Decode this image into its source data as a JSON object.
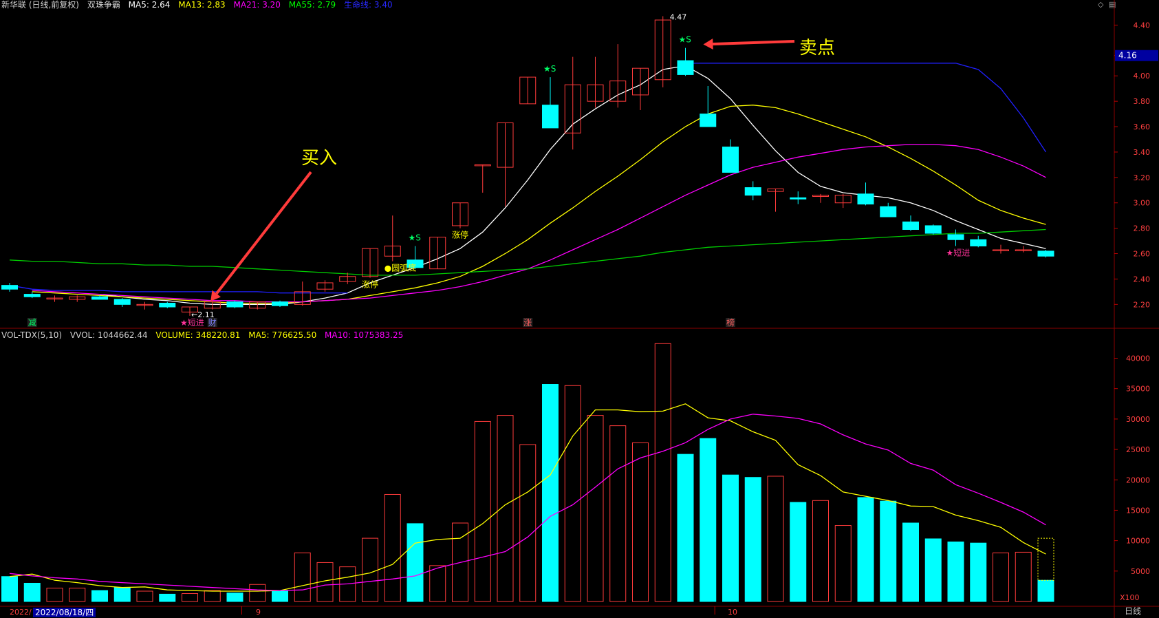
{
  "header": {
    "title": "新华联 (日线,前复权)",
    "indicator": "双珠争霸",
    "ma5": "MA5: 2.64",
    "ma13": "MA13: 2.83",
    "ma21": "MA21: 3.20",
    "ma55": "MA55: 2.79",
    "lifeline": "生命线: 3.40"
  },
  "vol_header": {
    "name": "VOL-TDX(5,10)",
    "vvol": "VVOL: 1044662.44",
    "volume": "VOLUME: 348220.81",
    "ma5": "MA5: 776625.50",
    "ma10": "MA10: 1075383.25"
  },
  "bottom": {
    "year_label": "2022/",
    "cursor_date": "2022/08/18/四",
    "month_9": "9",
    "month_10": "10",
    "period": "日线"
  },
  "colors": {
    "up": "#ff3b3b",
    "down": "#00ffff",
    "ma5": "#ffffff",
    "ma13": "#ffff00",
    "ma21": "#ff00ff",
    "ma55": "#00cc00",
    "lifeline": "#2020ff",
    "grid": "#8b0000"
  },
  "chart_data": [
    {
      "type": "candlestick",
      "title": "新华联 (日线,前复权)",
      "ylim": [
        2.05,
        4.5
      ],
      "y_ticks": [
        "4.40",
        "4.16",
        "4.00",
        "3.80",
        "3.60",
        "3.40",
        "3.20",
        "3.00",
        "2.80",
        "2.60",
        "2.40",
        "2.20"
      ],
      "current_price_label": "4.16",
      "candles": [
        {
          "o": 2.35,
          "h": 2.37,
          "l": 2.3,
          "c": 2.32
        },
        {
          "o": 2.28,
          "h": 2.3,
          "l": 2.25,
          "c": 2.26
        },
        {
          "o": 2.25,
          "h": 2.27,
          "l": 2.22,
          "c": 2.25
        },
        {
          "o": 2.24,
          "h": 2.27,
          "l": 2.22,
          "c": 2.26
        },
        {
          "o": 2.26,
          "h": 2.27,
          "l": 2.24,
          "c": 2.24
        },
        {
          "o": 2.24,
          "h": 2.25,
          "l": 2.18,
          "c": 2.2
        },
        {
          "o": 2.2,
          "h": 2.22,
          "l": 2.16,
          "c": 2.2
        },
        {
          "o": 2.21,
          "h": 2.22,
          "l": 2.17,
          "c": 2.18
        },
        {
          "o": 2.14,
          "h": 2.18,
          "l": 2.11,
          "c": 2.18
        },
        {
          "o": 2.17,
          "h": 2.22,
          "l": 2.16,
          "c": 2.22
        },
        {
          "o": 2.22,
          "h": 2.23,
          "l": 2.17,
          "c": 2.18
        },
        {
          "o": 2.17,
          "h": 2.22,
          "l": 2.16,
          "c": 2.22
        },
        {
          "o": 2.22,
          "h": 2.23,
          "l": 2.18,
          "c": 2.19
        },
        {
          "o": 2.2,
          "h": 2.38,
          "l": 2.19,
          "c": 2.3
        },
        {
          "o": 2.32,
          "h": 2.39,
          "l": 2.3,
          "c": 2.37
        },
        {
          "o": 2.38,
          "h": 2.45,
          "l": 2.36,
          "c": 2.42
        },
        {
          "o": 2.42,
          "h": 2.64,
          "l": 2.41,
          "c": 2.64
        },
        {
          "o": 2.58,
          "h": 2.9,
          "l": 2.54,
          "c": 2.66
        },
        {
          "o": 2.55,
          "h": 2.66,
          "l": 2.48,
          "c": 2.49
        },
        {
          "o": 2.48,
          "h": 2.73,
          "l": 2.48,
          "c": 2.73
        },
        {
          "o": 2.82,
          "h": 3.0,
          "l": 2.8,
          "c": 3.0
        },
        {
          "o": 3.3,
          "h": 3.3,
          "l": 3.08,
          "c": 3.3
        },
        {
          "o": 3.28,
          "h": 3.63,
          "l": 2.97,
          "c": 3.63
        },
        {
          "o": 3.78,
          "h": 3.99,
          "l": 3.78,
          "c": 3.99
        },
        {
          "o": 3.77,
          "h": 3.99,
          "l": 3.59,
          "c": 3.59
        },
        {
          "o": 3.55,
          "h": 4.15,
          "l": 3.42,
          "c": 3.93
        },
        {
          "o": 3.8,
          "h": 4.15,
          "l": 3.75,
          "c": 3.93
        },
        {
          "o": 3.8,
          "h": 4.25,
          "l": 3.75,
          "c": 3.96
        },
        {
          "o": 3.85,
          "h": 4.06,
          "l": 3.73,
          "c": 4.06
        },
        {
          "o": 3.97,
          "h": 4.47,
          "l": 3.91,
          "c": 4.44
        },
        {
          "o": 4.12,
          "h": 4.22,
          "l": 4.0,
          "c": 4.01
        },
        {
          "o": 3.7,
          "h": 3.92,
          "l": 3.6,
          "c": 3.6
        },
        {
          "o": 3.44,
          "h": 3.5,
          "l": 3.24,
          "c": 3.24
        },
        {
          "o": 3.12,
          "h": 3.17,
          "l": 3.02,
          "c": 3.06
        },
        {
          "o": 3.09,
          "h": 3.11,
          "l": 2.93,
          "c": 3.11
        },
        {
          "o": 3.04,
          "h": 3.09,
          "l": 2.99,
          "c": 3.03
        },
        {
          "o": 3.05,
          "h": 3.07,
          "l": 3.0,
          "c": 3.06
        },
        {
          "o": 3.0,
          "h": 3.07,
          "l": 2.96,
          "c": 3.06
        },
        {
          "o": 3.07,
          "h": 3.16,
          "l": 2.98,
          "c": 2.99
        },
        {
          "o": 2.97,
          "h": 3.0,
          "l": 2.89,
          "c": 2.89
        },
        {
          "o": 2.85,
          "h": 2.9,
          "l": 2.78,
          "c": 2.79
        },
        {
          "o": 2.82,
          "h": 2.83,
          "l": 2.75,
          "c": 2.76
        },
        {
          "o": 2.75,
          "h": 2.79,
          "l": 2.66,
          "c": 2.71
        },
        {
          "o": 2.71,
          "h": 2.74,
          "l": 2.65,
          "c": 2.66
        },
        {
          "o": 2.63,
          "h": 2.67,
          "l": 2.6,
          "c": 2.63
        },
        {
          "o": 2.63,
          "h": 2.66,
          "l": 2.61,
          "c": 2.63
        },
        {
          "o": 2.62,
          "h": 2.63,
          "l": 2.57,
          "c": 2.58
        }
      ],
      "series": [
        {
          "name": "MA5",
          "color": "#ffffff",
          "values": [
            null,
            null,
            null,
            null,
            2.28,
            2.26,
            2.24,
            2.23,
            2.21,
            2.2,
            2.2,
            2.2,
            2.2,
            2.22,
            2.25,
            2.29,
            2.37,
            2.43,
            2.49,
            2.56,
            2.64,
            2.77,
            2.96,
            3.18,
            3.42,
            3.62,
            3.74,
            3.85,
            3.93,
            4.05,
            4.08,
            3.98,
            3.82,
            3.61,
            3.41,
            3.24,
            3.13,
            3.08,
            3.06,
            3.04,
            3.0,
            2.94,
            2.86,
            2.79,
            2.72,
            2.68,
            2.64
          ]
        },
        {
          "name": "MA13",
          "color": "#ffff00",
          "values": [
            null,
            2.3,
            2.29,
            2.28,
            2.27,
            2.26,
            2.25,
            2.24,
            2.23,
            2.22,
            2.21,
            2.21,
            2.21,
            2.22,
            2.23,
            2.24,
            2.27,
            2.3,
            2.33,
            2.37,
            2.42,
            2.5,
            2.6,
            2.71,
            2.84,
            2.96,
            3.09,
            3.21,
            3.34,
            3.48,
            3.6,
            3.7,
            3.76,
            3.77,
            3.75,
            3.7,
            3.64,
            3.58,
            3.52,
            3.44,
            3.35,
            3.25,
            3.14,
            3.02,
            2.94,
            2.88,
            2.83
          ]
        },
        {
          "name": "MA21",
          "color": "#ff00ff",
          "values": [
            null,
            2.31,
            2.3,
            2.29,
            2.28,
            2.27,
            2.26,
            2.25,
            2.24,
            2.23,
            2.23,
            2.22,
            2.22,
            2.22,
            2.23,
            2.24,
            2.25,
            2.27,
            2.29,
            2.31,
            2.34,
            2.38,
            2.43,
            2.48,
            2.55,
            2.63,
            2.71,
            2.79,
            2.88,
            2.97,
            3.06,
            3.14,
            3.22,
            3.28,
            3.32,
            3.36,
            3.39,
            3.42,
            3.44,
            3.45,
            3.46,
            3.46,
            3.45,
            3.42,
            3.36,
            3.29,
            3.2
          ]
        },
        {
          "name": "MA55",
          "color": "#00cc00",
          "values": [
            2.55,
            2.54,
            2.54,
            2.53,
            2.52,
            2.52,
            2.51,
            2.51,
            2.5,
            2.5,
            2.49,
            2.48,
            2.47,
            2.46,
            2.45,
            2.44,
            2.43,
            2.43,
            2.43,
            2.44,
            2.45,
            2.46,
            2.47,
            2.48,
            2.5,
            2.52,
            2.54,
            2.56,
            2.58,
            2.61,
            2.63,
            2.65,
            2.66,
            2.67,
            2.68,
            2.69,
            2.7,
            2.71,
            2.72,
            2.73,
            2.74,
            2.75,
            2.76,
            2.76,
            2.77,
            2.78,
            2.79
          ]
        },
        {
          "name": "生命线",
          "color": "#2020ff",
          "values": [
            2.35,
            2.32,
            2.31,
            2.31,
            2.31,
            2.3,
            2.3,
            2.3,
            2.3,
            2.3,
            2.3,
            2.3,
            2.29,
            2.29,
            2.29,
            2.29,
            null,
            null,
            null,
            null,
            null,
            null,
            null,
            null,
            null,
            null,
            null,
            null,
            null,
            null,
            4.1,
            4.1,
            4.1,
            4.1,
            4.1,
            4.1,
            4.1,
            4.1,
            4.1,
            4.1,
            4.1,
            4.1,
            4.1,
            4.05,
            3.9,
            3.67,
            3.4
          ]
        }
      ],
      "annotations": [
        {
          "text": "买入",
          "candle": 9,
          "kind": "arrow-label"
        },
        {
          "text": "卖点",
          "candle": 30,
          "kind": "arrow-label"
        },
        {
          "text": "2.11",
          "candle": 8,
          "kind": "low-label"
        },
        {
          "text": "4.47",
          "candle": 29,
          "kind": "high-label"
        },
        {
          "text": "★S",
          "candle": 18,
          "kind": "signal-green"
        },
        {
          "text": "★S",
          "candle": 24,
          "kind": "signal-green"
        },
        {
          "text": "★S",
          "candle": 30,
          "kind": "signal-green"
        },
        {
          "text": "★短进",
          "candle": 8,
          "kind": "signal-pink"
        },
        {
          "text": "★短进",
          "candle": 42,
          "kind": "signal-pink"
        },
        {
          "text": "涨停",
          "candle": 16,
          "kind": "label-yellow"
        },
        {
          "text": "涨停",
          "candle": 20,
          "kind": "label-yellow"
        },
        {
          "text": "●圆弧底",
          "candle": 17,
          "kind": "label-yellow"
        }
      ],
      "event_markers": [
        {
          "text": "减",
          "candle": 1
        },
        {
          "text": "财",
          "candle": 9
        },
        {
          "text": "涨",
          "candle": 23
        },
        {
          "text": "榜",
          "candle": 32
        }
      ]
    },
    {
      "type": "bar",
      "title": "VOL-TDX(5,10)",
      "ylim": [
        0,
        43000
      ],
      "y_ticks": [
        "40000",
        "35000",
        "30000",
        "25000",
        "20000",
        "15000",
        "10000",
        "5000"
      ],
      "unit_label": "X100",
      "values": [
        4100,
        3000,
        2200,
        2200,
        1800,
        2300,
        1700,
        1200,
        1300,
        1800,
        1400,
        2800,
        1700,
        8000,
        6400,
        5700,
        10400,
        17600,
        12800,
        5900,
        12900,
        29600,
        30600,
        25800,
        35700,
        35500,
        30600,
        28900,
        26100,
        42400,
        24200,
        26800,
        20800,
        20400,
        20600,
        16300,
        16600,
        12500,
        17100,
        16500,
        12900,
        10300,
        9800,
        9600,
        8000,
        8100,
        3482
      ],
      "series": [
        {
          "name": "MA5",
          "color": "#ffff00",
          "values": [
            4100,
            4500,
            3500,
            3100,
            2600,
            2300,
            2400,
            1900,
            1800,
            1700,
            1700,
            1700,
            1800,
            2600,
            3400,
            4000,
            4700,
            6100,
            9600,
            10200,
            10400,
            12800,
            15900,
            18000,
            20800,
            27200,
            31500,
            31500,
            31200,
            31300,
            32500,
            30200,
            29700,
            27900,
            26500,
            22500,
            20700,
            18000,
            17300,
            16600,
            15700,
            15600,
            14200,
            13300,
            12200,
            9700,
            7800
          ]
        },
        {
          "name": "MA10",
          "color": "#ff00ff",
          "values": [
            4600,
            4200,
            3900,
            3700,
            3300,
            3100,
            2900,
            2700,
            2500,
            2300,
            2100,
            1900,
            1800,
            1900,
            2700,
            2900,
            3300,
            3700,
            4200,
            5500,
            6400,
            7300,
            8200,
            10600,
            14000,
            15900,
            18800,
            21800,
            23600,
            24700,
            26100,
            28300,
            30000,
            30800,
            30500,
            30100,
            29200,
            27400,
            25900,
            24900,
            22700,
            21600,
            19200,
            17800,
            16300,
            14700,
            12600
          ]
        }
      ]
    }
  ]
}
